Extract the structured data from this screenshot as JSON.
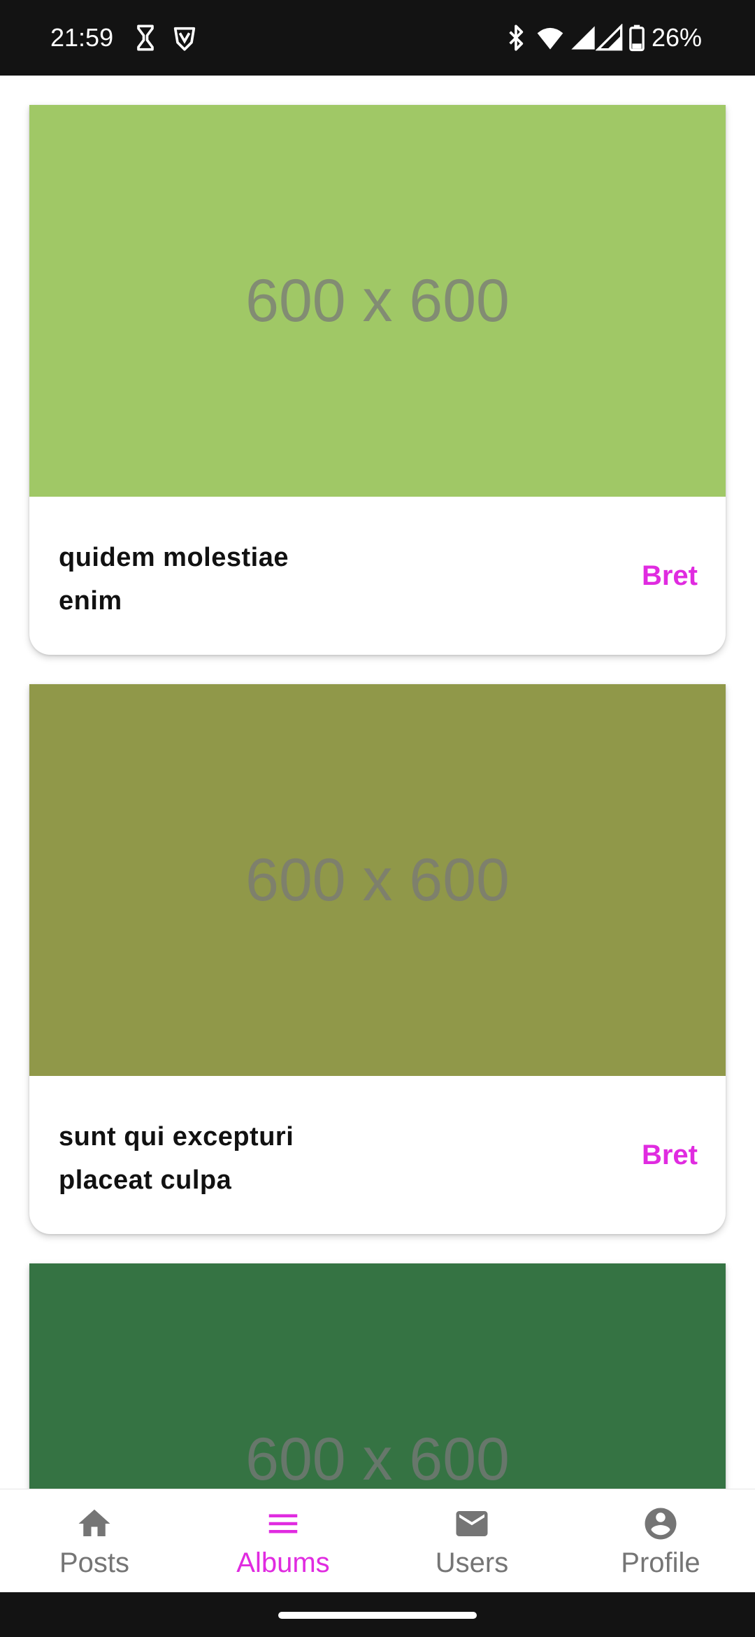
{
  "status_bar": {
    "time": "21:59",
    "battery": "26%",
    "icons": [
      "hourglass-icon",
      "vpn-shield-icon",
      "bluetooth-icon",
      "wifi-icon",
      "signal-icon",
      "signal-icon",
      "battery-icon"
    ]
  },
  "cards": [
    {
      "image_text": "600 x 600",
      "image_color": "#a0c866",
      "title": "quidem molestiae enim",
      "user": "Bret"
    },
    {
      "image_text": "600 x 600",
      "image_color": "#909849",
      "title": "sunt qui excepturi placeat culpa",
      "user": "Bret"
    },
    {
      "image_text": "600 x 600",
      "image_color": "#357343",
      "title": "",
      "user": ""
    }
  ],
  "bottom_nav": {
    "items": [
      {
        "label": "Posts",
        "icon": "home-icon",
        "active": false
      },
      {
        "label": "Albums",
        "icon": "menu-icon",
        "active": true
      },
      {
        "label": "Users",
        "icon": "mail-icon",
        "active": false
      },
      {
        "label": "Profile",
        "icon": "account-circle-icon",
        "active": false
      }
    ]
  },
  "colors": {
    "accent": "#e02be0",
    "inactive": "#757575",
    "status_bar_bg": "#131313"
  }
}
